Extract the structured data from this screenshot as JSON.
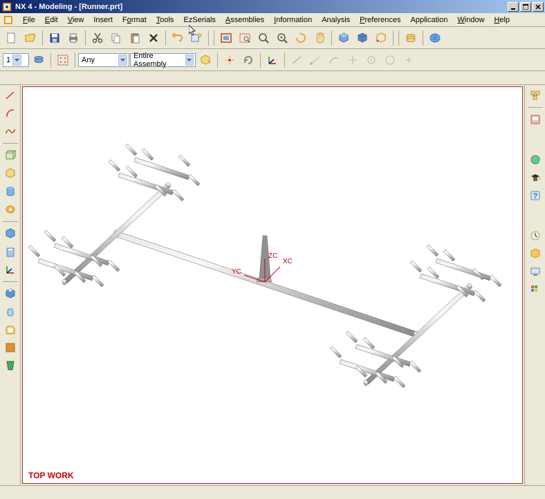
{
  "window": {
    "title": "NX 4 - Modeling - [Runner.prt]",
    "min_label": "_",
    "max_label": "□",
    "close_label": "×"
  },
  "menubar": {
    "items": [
      {
        "label": "File",
        "u": "F"
      },
      {
        "label": "Edit",
        "u": "E"
      },
      {
        "label": "View",
        "u": "V"
      },
      {
        "label": "Insert",
        "u": ""
      },
      {
        "label": "Format",
        "u": ""
      },
      {
        "label": "Tools",
        "u": "T"
      },
      {
        "label": "EzSerials",
        "u": ""
      },
      {
        "label": "Assemblies",
        "u": "A"
      },
      {
        "label": "Information",
        "u": "I"
      },
      {
        "label": "Analysis",
        "u": ""
      },
      {
        "label": "Preferences",
        "u": "P"
      },
      {
        "label": "Application",
        "u": ""
      },
      {
        "label": "Window",
        "u": "W"
      },
      {
        "label": "Help",
        "u": "H"
      }
    ]
  },
  "toolbar1": {
    "selector_value": "1",
    "filter_type": "Any",
    "assembly_scope": "Entire Assembly"
  },
  "viewport": {
    "label": "TOP WORK",
    "axis_x": "XC",
    "axis_y": "YC",
    "axis_z": "ZC"
  },
  "icons": {
    "app": "nx-app-icon",
    "new": "new-file-icon",
    "open": "open-folder-icon",
    "save": "save-disk-icon",
    "print": "printer-icon",
    "cut": "scissors-icon",
    "copy": "copy-icon",
    "paste": "paste-icon",
    "delete": "delete-x-icon",
    "undo": "undo-icon",
    "redo": "redo-icon",
    "fit": "fit-window-icon",
    "zoom-area": "zoom-area-icon",
    "zoom": "zoom-icon",
    "rotate": "rotate-icon",
    "pan": "pan-icon",
    "shade": "shade-cube-icon"
  }
}
